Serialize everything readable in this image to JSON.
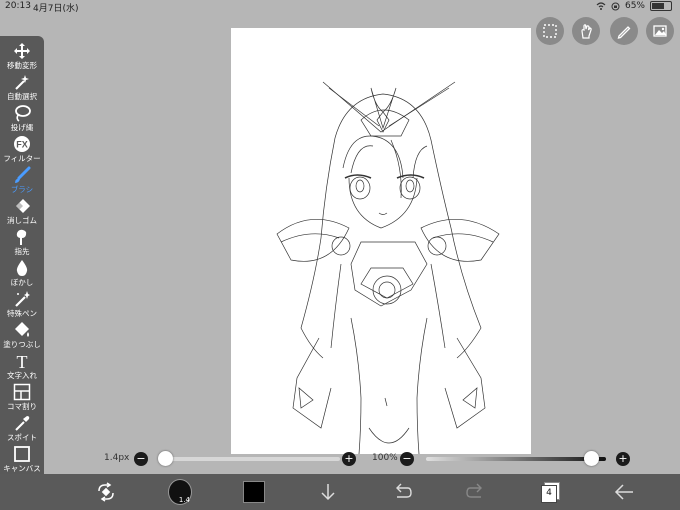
{
  "status_bar": {
    "time": "20:13",
    "date": "4月7日(水)",
    "battery": "65%",
    "battery_level": 0.65
  },
  "toolbar": {
    "items": [
      {
        "label": "移動変形",
        "icon": "move-icon"
      },
      {
        "label": "自動選択",
        "icon": "magic-wand-icon"
      },
      {
        "label": "投げ縄",
        "icon": "lasso-icon"
      },
      {
        "label": "フィルター",
        "icon": "fx-icon"
      },
      {
        "label": "ブラシ",
        "icon": "brush-icon",
        "active": true
      },
      {
        "label": "消しゴム",
        "icon": "eraser-icon"
      },
      {
        "label": "指先",
        "icon": "finger-icon"
      },
      {
        "label": "ぼかし",
        "icon": "blur-drop-icon"
      },
      {
        "label": "特殊ペン",
        "icon": "special-pen-icon"
      },
      {
        "label": "塗りつぶし",
        "icon": "fill-bucket-icon"
      },
      {
        "label": "文字入れ",
        "icon": "text-icon"
      },
      {
        "label": "コマ割り",
        "icon": "frame-divide-icon"
      },
      {
        "label": "スポイト",
        "icon": "eyedropper-icon"
      },
      {
        "label": "キャンバス",
        "icon": "canvas-icon"
      }
    ]
  },
  "fx_glyph": "FX",
  "text_glyph": "T",
  "brush_size": {
    "label": "1.4px",
    "minus": "−",
    "plus": "+",
    "value_fraction": 0.0
  },
  "opacity": {
    "label": "100%",
    "minus": "−",
    "plus": "+",
    "value_fraction": 1.0
  },
  "brush_preview_size": "1.4",
  "layer_count": "4",
  "colors": {
    "accent": "#4a9cff",
    "current_color": "#000000",
    "toolbar_bg": "#595959",
    "bottom_bg": "#5a5a5a"
  }
}
